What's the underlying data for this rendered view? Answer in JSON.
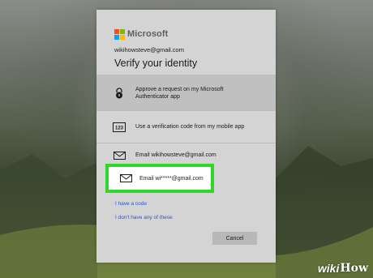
{
  "brand": {
    "name": "Microsoft",
    "logo_colors": [
      "#f25022",
      "#7fba00",
      "#00a4ef",
      "#ffb900"
    ]
  },
  "account": {
    "email": "wikihowsteve@gmail.com"
  },
  "title": "Verify your identity",
  "options": [
    {
      "icon": "lock-icon",
      "label": "Approve a request on my Microsoft Authenticator app",
      "selected": true
    },
    {
      "icon": "code-123-icon",
      "label": "Use a verification code from my mobile app",
      "icon_text": "123"
    },
    {
      "icon": "mail-icon",
      "label": "Email wikihowsteve@gmail.com"
    },
    {
      "icon": "mail-icon",
      "label": "Email wi*****@gmail.com",
      "highlighted": true
    }
  ],
  "links": {
    "have_code": "I have a code",
    "dont_have": "I don't have any of these"
  },
  "buttons": {
    "cancel": "Cancel"
  },
  "watermark": {
    "wiki": "wiki",
    "how": "How"
  },
  "colors": {
    "highlight_border": "#2fd72a",
    "link": "#2b56c4",
    "dialog_bg": "#d4d4d4"
  }
}
